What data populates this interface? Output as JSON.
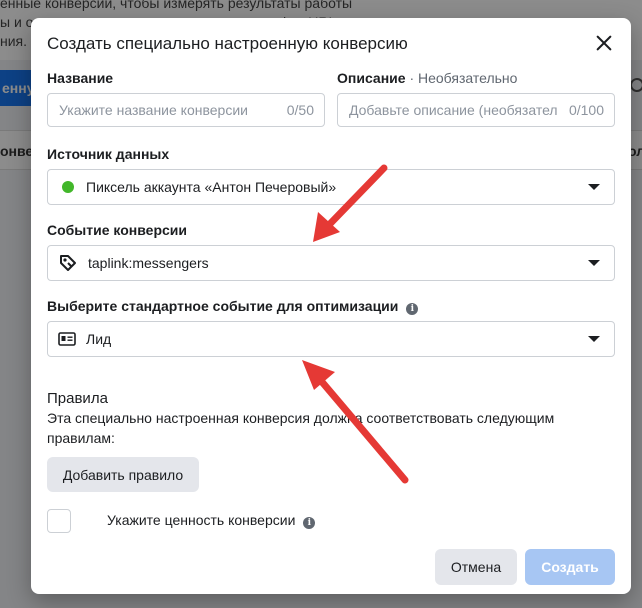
{
  "background": {
    "text_lines": [
      "енные конверсии, чтобы измерять результаты работы",
      "ы и оптимизировать свою рекламу под трафик URL и",
      "ния. По"
    ],
    "button_label": "енну",
    "row_left": "онве",
    "row_right": "ол"
  },
  "modal": {
    "title": "Создать специально настроенную конверсию",
    "name": {
      "label": "Название",
      "placeholder": "Укажите название конверсии",
      "counter": "0/50"
    },
    "description": {
      "label": "Описание",
      "optional_label": "· Необязательно",
      "placeholder": "Добавьте описание (необязател",
      "counter": "0/100"
    },
    "data_source": {
      "label": "Источник данных",
      "value": "Пиксель аккаунта «Антон Печеровый»",
      "status_color": "#42b72a"
    },
    "conversion_event": {
      "label": "Событие конверсии",
      "value": "taplink:messengers",
      "icon": "tag-icon"
    },
    "standard_event": {
      "label": "Выберите стандартное событие для оптимизации",
      "value": "Лид",
      "icon": "id-card-icon"
    },
    "rules": {
      "title": "Правила",
      "description": "Эта специально настроенная конверсия должна соответствовать следующим правилам:",
      "add_rule_label": "Добавить правило"
    },
    "conversion_value": {
      "label": "Укажите ценность конверсии"
    },
    "footer": {
      "cancel_label": "Отмена",
      "create_label": "Создать"
    }
  },
  "colors": {
    "primary_disabled": "#a7c6f3",
    "annotation_arrow": "#e53935"
  }
}
